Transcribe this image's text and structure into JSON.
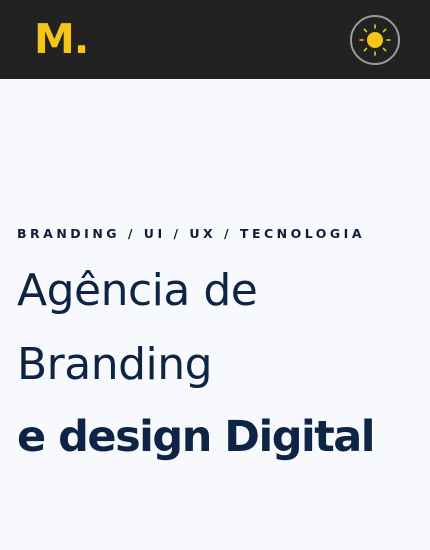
{
  "header": {
    "logo_text": "M.",
    "theme_toggle_icon": "sun-icon",
    "accent_color": "#f5c518",
    "background_color": "#222222"
  },
  "hero": {
    "eyebrow": "BRANDING / UI / UX / TECNOLOGIA",
    "headline_line1": "Agência de",
    "headline_line2": "Branding",
    "headline_line3": "e design Digital",
    "text_color": "#0d2445"
  }
}
